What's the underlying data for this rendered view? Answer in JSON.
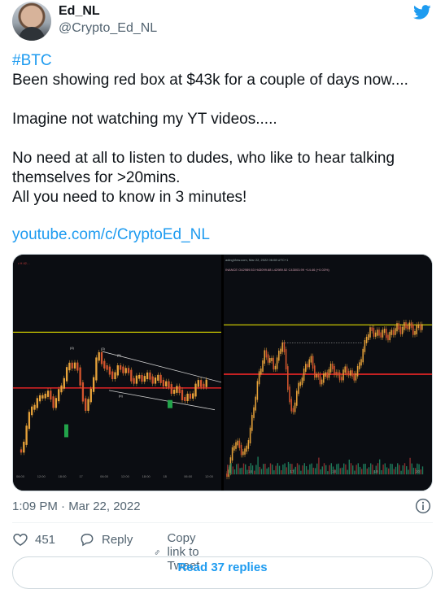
{
  "author": {
    "name": "Ed_NL",
    "handle": "@Crypto_Ed_NL"
  },
  "tweet": {
    "hashtag": "#BTC",
    "body": "Been showing red box at $43k for a couple of days now....\n\nImagine not watching my YT videos.....\n\nNo need at all to listen to dudes, who like to hear talking themselves for >20mins.\nAll you need to know in 3 minutes!",
    "link": "youtube.com/c/CryptoEd_NL"
  },
  "media": {
    "left_chart": {
      "header": "• H  42…",
      "x_ticks": [
        "06:00",
        "12:00",
        "18:00",
        "17",
        "06:00",
        "12:00",
        "18:00",
        "18",
        "06:00",
        "12:00"
      ]
    },
    "right_chart": {
      "header_line1": "adingView.com, Mar 22, 2022 06:08 UTC+1",
      "header_line2": "INANCE  O42989.53  H43099.68  L42989.52  C43003.99  +14.46 (+0.03%)",
      "x_ticks": [
        "16",
        "17",
        "18",
        "19",
        "20"
      ]
    }
  },
  "meta": {
    "timestamp": "1:09 PM · Mar 22, 2022"
  },
  "actions": {
    "likes": "451",
    "reply": "Reply",
    "copy": "Copy link to Tweet"
  },
  "replies_button": "Read 37 replies",
  "colors": {
    "accent": "#1d9bf0",
    "yellow_line": "#c8c400",
    "red_line": "#e02424",
    "candle": "#e8a33a"
  }
}
